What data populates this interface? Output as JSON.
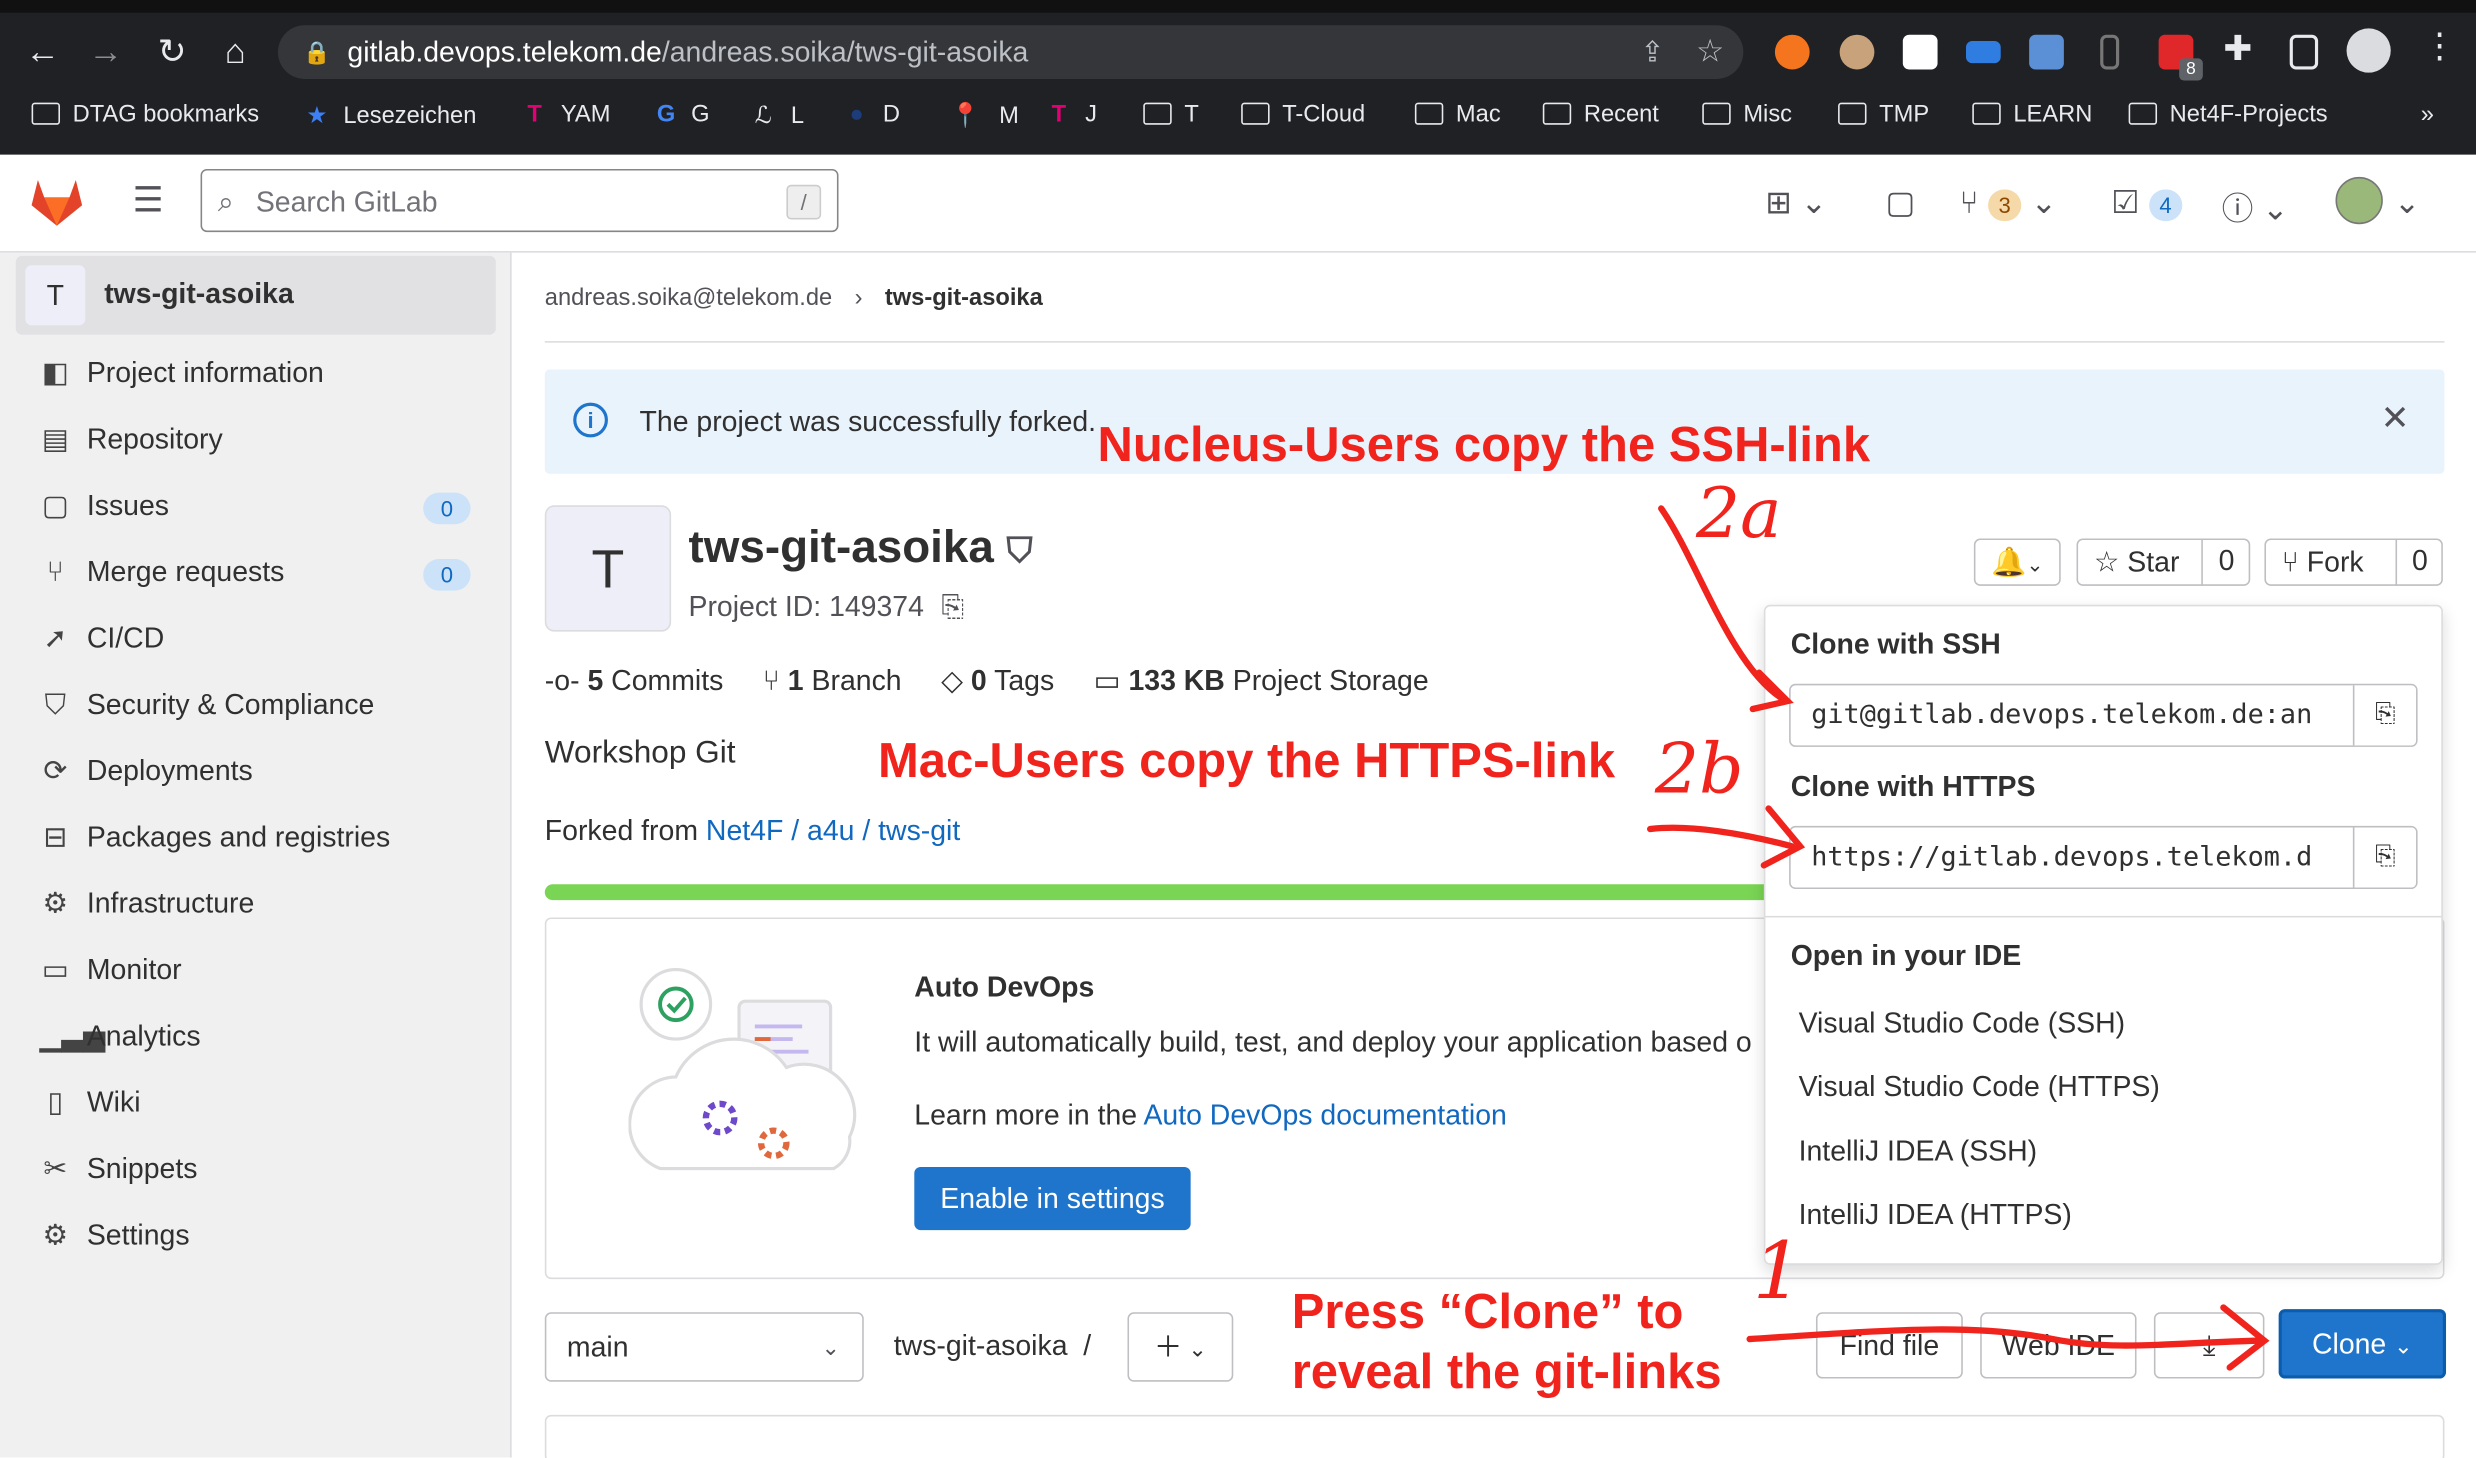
{
  "browser": {
    "url_host": "gitlab.devops.telekom.de",
    "url_path": "/andreas.soika/tws-git-asoika",
    "ext_badge": "8",
    "bookmarks": [
      "DTAG bookmarks",
      "Lesezeichen",
      "YAM",
      "G",
      "L",
      "D",
      "M",
      "J",
      "T",
      "T-Cloud",
      "Mac",
      "Recent",
      "Misc",
      "TMP",
      "LEARN",
      "Net4F-Projects"
    ],
    "more": "»"
  },
  "header": {
    "search_placeholder": "Search GitLab",
    "search_shortcut": "/",
    "mr_count": "3",
    "todo_count": "4"
  },
  "sidebar": {
    "project_initial": "T",
    "project_name": "tws-git-asoika",
    "items": [
      {
        "label": "Project information",
        "icon": "info-icon"
      },
      {
        "label": "Repository",
        "icon": "document-icon"
      },
      {
        "label": "Issues",
        "icon": "issues-icon",
        "count": "0"
      },
      {
        "label": "Merge requests",
        "icon": "merge-request-icon",
        "count": "0"
      },
      {
        "label": "CI/CD",
        "icon": "rocket-icon"
      },
      {
        "label": "Security & Compliance",
        "icon": "shield-icon"
      },
      {
        "label": "Deployments",
        "icon": "deployments-icon"
      },
      {
        "label": "Packages and registries",
        "icon": "package-icon"
      },
      {
        "label": "Infrastructure",
        "icon": "cloud-gear-icon"
      },
      {
        "label": "Monitor",
        "icon": "monitor-icon"
      },
      {
        "label": "Analytics",
        "icon": "chart-icon"
      },
      {
        "label": "Wiki",
        "icon": "book-icon"
      },
      {
        "label": "Snippets",
        "icon": "scissors-icon"
      },
      {
        "label": "Settings",
        "icon": "gear-icon"
      }
    ]
  },
  "breadcrumb": {
    "user": "andreas.soika@telekom.de",
    "project": "tws-git-asoika",
    "sep": "›"
  },
  "alert": {
    "text": "The project was successfully forked."
  },
  "project": {
    "initial": "T",
    "name": "tws-git-asoika",
    "id_label": "Project ID: 149374",
    "commits_count": "5",
    "commits_label": "Commits",
    "branch_count": "1",
    "branch_label": "Branch",
    "tags_count": "0",
    "tags_label": "Tags",
    "storage_count": "133 KB",
    "storage_label": "Project Storage",
    "description": "Workshop Git",
    "forked_from_label": "Forked from",
    "forked_from_link": "Net4F / a4u / tws-git"
  },
  "actions": {
    "star_label": "Star",
    "star_count": "0",
    "fork_label": "Fork",
    "fork_count": "0"
  },
  "autodevops": {
    "title": "Auto DevOps",
    "text": "It will automatically build, test, and deploy your application based o",
    "learn_more": "Learn more in the",
    "doc_link": "Auto DevOps documentation",
    "button": "Enable in settings"
  },
  "repo_bar": {
    "branch": "main",
    "path": "tws-git-asoika",
    "path_sep": "/",
    "find_file": "Find file",
    "web_ide": "Web IDE",
    "clone": "Clone"
  },
  "clone_panel": {
    "ssh_heading": "Clone with SSH",
    "ssh_url": "git@gitlab.devops.telekom.de:an",
    "https_heading": "Clone with HTTPS",
    "https_url": "https://gitlab.devops.telekom.d",
    "ide_heading": "Open in your IDE",
    "ide_options": [
      "Visual Studio Code (SSH)",
      "Visual Studio Code (HTTPS)",
      "IntelliJ IDEA (SSH)",
      "IntelliJ IDEA (HTTPS)"
    ]
  },
  "annotations": {
    "ssh_note": "Nucleus-Users copy the SSH-link",
    "ssh_step": "2a",
    "https_note": "Mac-Users copy the HTTPS-link",
    "https_step": "2b",
    "clone_note_line1": "Press “Clone” to",
    "clone_note_line2": "reveal the git-links",
    "clone_step": "1"
  },
  "colors": {
    "accent": "#1f75cb",
    "annotation": "#f0231d",
    "progress": "#7ad554",
    "sidebar_bg": "#f0f0f0"
  }
}
